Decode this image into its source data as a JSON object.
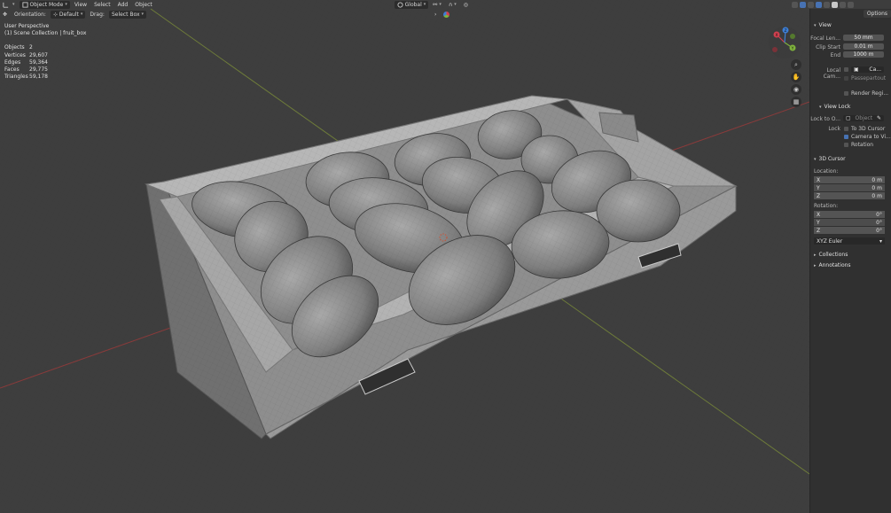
{
  "header": {
    "mode": "Object Mode",
    "menus": [
      "View",
      "Select",
      "Add",
      "Object"
    ],
    "orientation_label": "Orientation:",
    "orientation_value": "Default",
    "drag_label": "Drag:",
    "drag_value": "Select Box",
    "transform_orientation": "Global"
  },
  "overlay": {
    "perspective": "User Perspective",
    "collection": "(1) Scene Collection | fruit_box",
    "stats": [
      {
        "k": "Objects",
        "v": "2"
      },
      {
        "k": "Vertices",
        "v": "29,607"
      },
      {
        "k": "Edges",
        "v": "59,364"
      },
      {
        "k": "Faces",
        "v": "29,775"
      },
      {
        "k": "Triangles",
        "v": "59,178"
      }
    ]
  },
  "gizmo": {
    "x": "X",
    "y": "Y",
    "z": "Z",
    "colors": {
      "x": "#d2404f",
      "y": "#7fb33c",
      "z": "#3d7fd6"
    }
  },
  "npanel": {
    "options": "Options",
    "view_header": "View",
    "focal_label": "Focal Len...",
    "focal_value": "50 mm",
    "clip_start_label": "Clip Start",
    "clip_start_value": "0.01 m",
    "end_label": "End",
    "end_value": "1000 m",
    "local_cam_label": "Local Cam...",
    "local_cam_value": "Ca...",
    "passepartout": "Passepartout",
    "render_region": "Render Regi...",
    "view_lock_header": "View Lock",
    "lock_to_label": "Lock to O...",
    "lock_to_value": "Object",
    "lock_label": "Lock",
    "to_3d_cursor": "To 3D Cursor",
    "camera_to_view": "Camera to Vi...",
    "rotation_chk": "Rotation",
    "cursor_header": "3D Cursor",
    "location_label": "Location:",
    "loc": [
      {
        "a": "X",
        "v": "0 m"
      },
      {
        "a": "Y",
        "v": "0 m"
      },
      {
        "a": "Z",
        "v": "0 m"
      }
    ],
    "rotation_label": "Rotation:",
    "rot": [
      {
        "a": "X",
        "v": "0°"
      },
      {
        "a": "Y",
        "v": "0°"
      },
      {
        "a": "Z",
        "v": "0°"
      }
    ],
    "euler": "XYZ Euler",
    "collections": "Collections",
    "annotations": "Annotations"
  }
}
